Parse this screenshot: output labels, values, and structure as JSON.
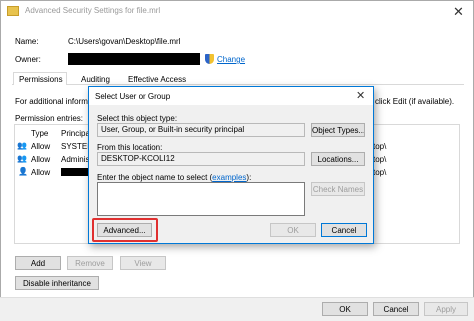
{
  "window": {
    "title": "Advanced Security Settings for file.mrl",
    "name_label": "Name:",
    "name_value": "C:\\Users\\govan\\Desktop\\file.mrl",
    "owner_label": "Owner:",
    "change_link": "Change",
    "tabs": [
      "Permissions",
      "Auditing",
      "Effective Access"
    ],
    "info_text_left": "For additional informat",
    "info_text_right": "click Edit (if available).",
    "entries_label": "Permission entries:",
    "columns": [
      "Type",
      "Principal"
    ],
    "rows": [
      {
        "type": "Allow",
        "principal": "SYSTEM",
        "path": "top\\"
      },
      {
        "type": "Allow",
        "principal": "Administ",
        "path": "top\\"
      },
      {
        "type": "Allow",
        "principal": "",
        "path": "top\\"
      }
    ],
    "buttons": {
      "add": "Add",
      "remove": "Remove",
      "view": "View",
      "disable_inheritance": "Disable inheritance",
      "ok": "OK",
      "cancel": "Cancel",
      "apply": "Apply"
    }
  },
  "dialog": {
    "title": "Select User or Group",
    "object_type_label": "Select this object type:",
    "object_type_value": "User, Group, or Built-in security principal",
    "object_types_button": "Object Types...",
    "location_label": "From this location:",
    "location_value": "DESKTOP-KCOLI12",
    "locations_button": "Locations...",
    "enter_label_prefix": "Enter the object name to select (",
    "enter_label_link": "examples",
    "enter_label_suffix": "):",
    "check_names_button": "Check Names",
    "advanced_button": "Advanced...",
    "ok_button": "OK",
    "cancel_button": "Cancel"
  },
  "colors": {
    "highlight": "#e03030",
    "dialog_border": "#0078d7",
    "link": "#0066cc"
  }
}
